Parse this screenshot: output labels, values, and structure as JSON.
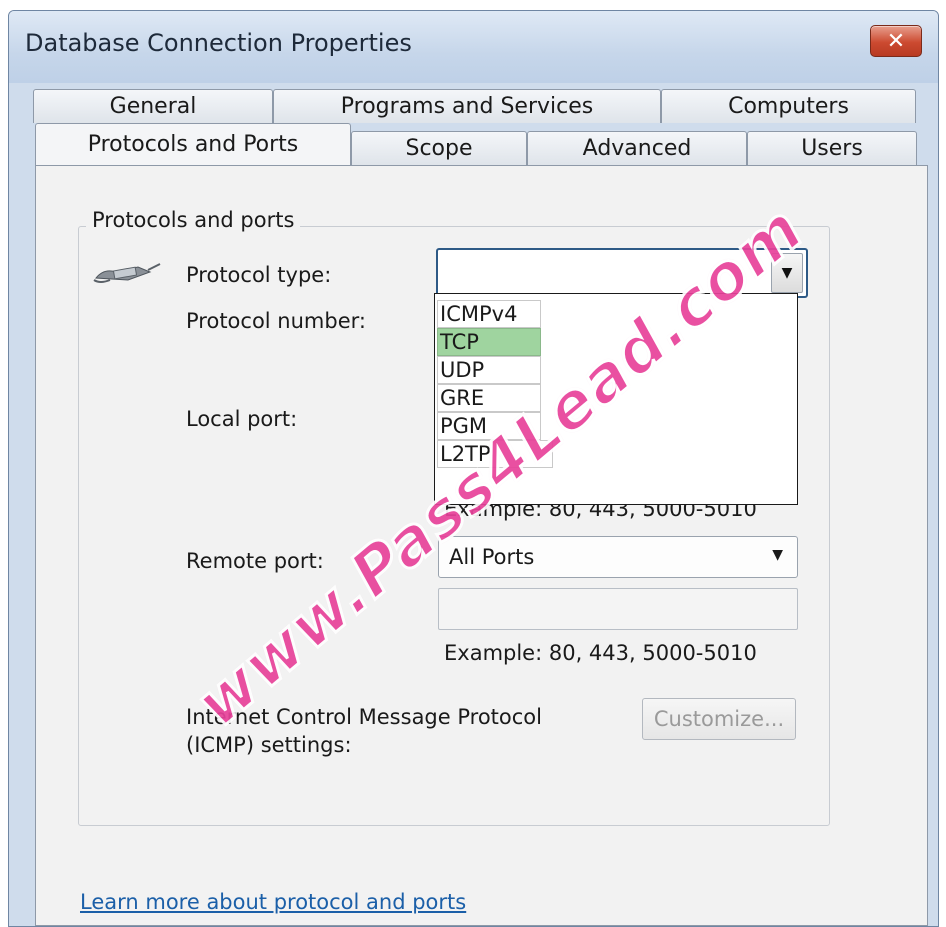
{
  "window": {
    "title": "Database Connection Properties",
    "close_glyph": "✕"
  },
  "tabs": {
    "row_back": [
      "General",
      "Programs and Services",
      "Computers"
    ],
    "row_front": [
      "Protocols and Ports",
      "Scope",
      "Advanced",
      "Users"
    ],
    "active": "Protocols and Ports"
  },
  "group": {
    "label": "Protocols and ports"
  },
  "fields": {
    "protocol_type_label": "Protocol type:",
    "protocol_type_value": "",
    "protocol_number_label": "Protocol number:",
    "local_port_label": "Local port:",
    "remote_port_label": "Remote port:",
    "remote_port_value": "All Ports",
    "remote_port_text": "",
    "example_local": "Example: 80, 443, 5000-5010",
    "example_remote": "Example: 80, 443, 5000-5010",
    "icmp_label_line1": "Internet Control Message Protocol",
    "icmp_label_line2": "(ICMP) settings:",
    "customize_button": "Customize..."
  },
  "dropdown": {
    "options": [
      "ICMPv4",
      "TCP",
      "UDP",
      "GRE",
      "PGM",
      "L2TP"
    ],
    "selected": "TCP"
  },
  "footer": {
    "learn_more_link": "Learn more about protocol and ports"
  },
  "watermark": {
    "text": "www.Pass4Lead.com"
  },
  "colors": {
    "selected_option": "#9fd49f",
    "close_button": "#cc4a30",
    "link": "#1b5fa8",
    "watermark": "#e8429a"
  }
}
